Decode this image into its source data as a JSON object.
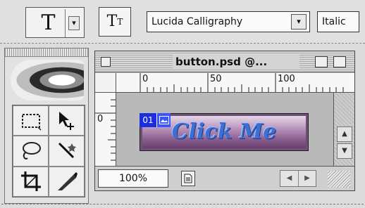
{
  "options_bar": {
    "tool_preset_glyph": "T",
    "tool_preset_arrow": "▾",
    "orientation_glyph": "T",
    "orientation_sub": "T",
    "font_family": "Lucida Calligraphy",
    "font_family_arrow": "▾",
    "font_style": "Italic"
  },
  "tools": [
    {
      "icon": "rectangular-marquee-icon"
    },
    {
      "icon": "move-icon"
    },
    {
      "icon": "lasso-icon"
    },
    {
      "icon": "magic-wand-icon"
    },
    {
      "icon": "crop-icon"
    },
    {
      "icon": "slice-icon"
    }
  ],
  "document": {
    "title": "button.psd @...",
    "ruler_h": [
      "0",
      "50",
      "100"
    ],
    "ruler_v": [
      "0"
    ],
    "image_text": "Click Me",
    "slice_number": "01",
    "zoom": "100%",
    "scroll_up": "▲",
    "scroll_down": "▼",
    "scroll_left": "◀",
    "scroll_right": "▶"
  },
  "colors": {
    "slice_badge": "#1a2ee0",
    "button_text": "#3d6fd4",
    "button_fill": "#8a5d8f"
  }
}
